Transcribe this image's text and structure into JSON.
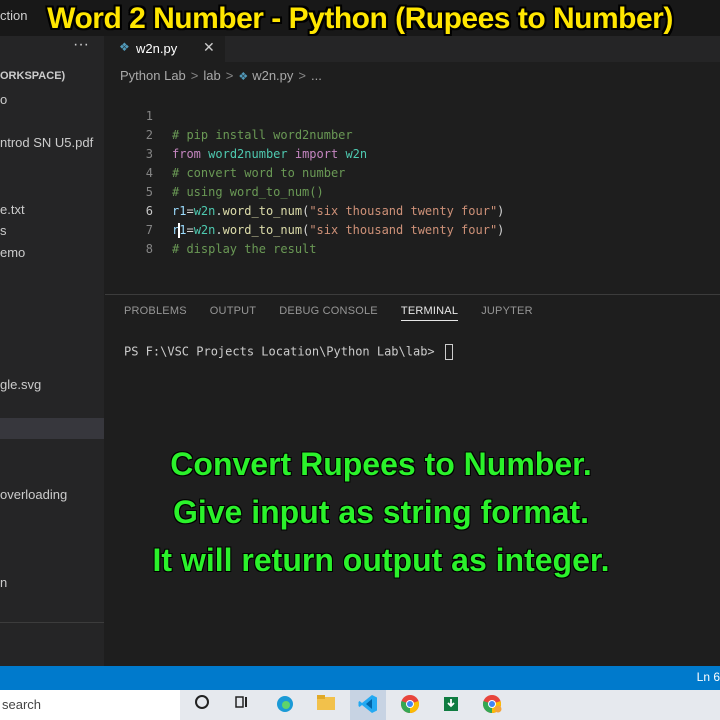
{
  "window": {
    "title_fragment": "ction"
  },
  "banner": {
    "text": "Word 2 Number - Python (Rupees to Number)"
  },
  "sidebar": {
    "more_label": "···",
    "items": [
      {
        "label": "ORKSPACE)"
      },
      {
        "label": "o"
      },
      {
        "label": "ntrod SN U5.pdf"
      },
      {
        "label": "e.txt"
      },
      {
        "label": "s"
      },
      {
        "label": "emo"
      },
      {
        "label": "gle.svg"
      },
      {
        "label": "overloading"
      },
      {
        "label": "n"
      }
    ]
  },
  "editor_tab": {
    "label": "w2n.py",
    "icon": "python-file-icon",
    "close": "✕"
  },
  "breadcrumb": {
    "parts": [
      "Python Lab",
      "lab",
      "w2n.py",
      "..."
    ]
  },
  "code": {
    "lines": [
      {
        "num": "1",
        "comment": "# pip install word2number"
      },
      {
        "num": "2",
        "kw_from": "from",
        "module": "word2number",
        "kw_import": "import",
        "name": "w2n"
      },
      {
        "num": "3",
        "comment": "# convert word to number"
      },
      {
        "num": "4",
        "comment": "# using word_to_num()"
      },
      {
        "num": "5",
        "var": "r1",
        "eq": "=",
        "obj": "w2n",
        "dot": ".",
        "fn": "word_to_num",
        "open": "(",
        "str": "\"six thousand twenty four\"",
        "close": ")"
      },
      {
        "num": "6",
        "var": "r1",
        "eq": "=",
        "obj": "w2n",
        "dot": ".",
        "fn": "word_to_num",
        "open": "(",
        "str": "\"six thousand twenty four\"",
        "close": ")"
      },
      {
        "num": "7",
        "comment": "# display the result"
      },
      {
        "num": "8"
      }
    ]
  },
  "panel": {
    "tabs": [
      "PROBLEMS",
      "OUTPUT",
      "DEBUG CONSOLE",
      "TERMINAL",
      "JUPYTER"
    ],
    "active_tab": "TERMINAL",
    "terminal_prompt": "PS F:\\VSC Projects Location\\Python Lab\\lab> "
  },
  "overlay": {
    "lines": [
      "Convert Rupees to Number.",
      "Give input as string format.",
      "It will return output as integer."
    ],
    "color": "#2bf22b"
  },
  "status_bar": {
    "position": "Ln 6",
    "color": "#007acc"
  },
  "taskbar": {
    "search_label": "search"
  }
}
